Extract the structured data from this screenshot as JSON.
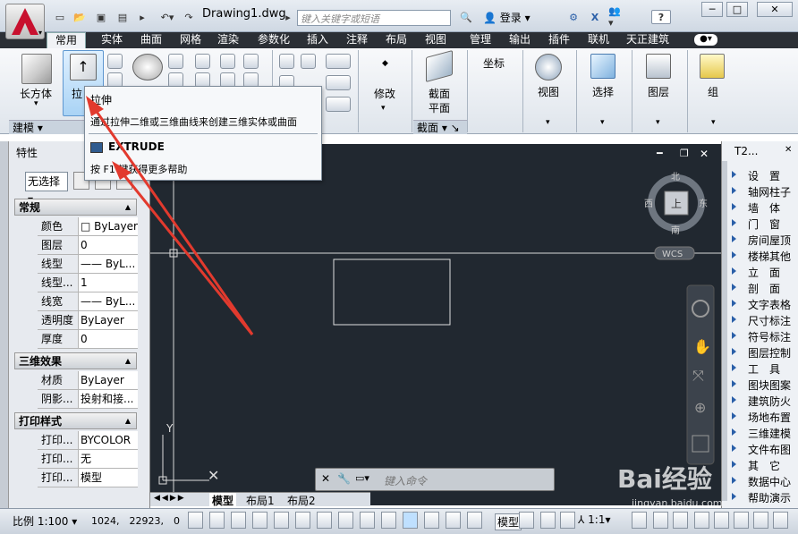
{
  "title_bar": {
    "document_title": "Drawing1.dwg",
    "search_placeholder": "键入关键字或短语",
    "login_label": "登录",
    "help_label": "?"
  },
  "tabs": [
    "常用",
    "实体",
    "曲面",
    "网格",
    "渲染",
    "参数化",
    "插入",
    "注释",
    "布局",
    "视图",
    "管理",
    "输出",
    "插件",
    "联机",
    "天正建筑"
  ],
  "active_tab": "常用",
  "ribbon": {
    "box_label": "长方体",
    "extrude_label": "拉",
    "modeling_group": "建模",
    "modify_label": "修改",
    "section_label_1": "截面",
    "section_label_2": "平面",
    "section_group": "截面",
    "coordinates_label": "坐标",
    "view_label": "视图",
    "select_label": "选择",
    "layer_label": "图层",
    "group_label": "组"
  },
  "tooltip": {
    "title": "拉伸",
    "description": "通过拉伸二维或三维曲线来创建三维实体或曲面",
    "command": "EXTRUDE",
    "help_text": "按 F1 键获得更多帮助"
  },
  "properties": {
    "panel_title": "特性",
    "selection_value": "无选择",
    "sections": [
      {
        "title": "常规",
        "rows": [
          {
            "key": "颜色",
            "value": "□ ByLayer"
          },
          {
            "key": "图层",
            "value": "0"
          },
          {
            "key": "线型",
            "value": "—— ByL..."
          },
          {
            "key": "线型...",
            "value": "1"
          },
          {
            "key": "线宽",
            "value": "—— ByL..."
          },
          {
            "key": "透明度",
            "value": "ByLayer"
          },
          {
            "key": "厚度",
            "value": "0"
          }
        ]
      },
      {
        "title": "三维效果",
        "rows": [
          {
            "key": "材质",
            "value": "ByLayer"
          },
          {
            "key": "阴影...",
            "value": "投射和接..."
          }
        ]
      },
      {
        "title": "打印样式",
        "rows": [
          {
            "key": "打印...",
            "value": "BYCOLOR"
          },
          {
            "key": "打印...",
            "value": "无"
          },
          {
            "key": "打印...",
            "value": "模型"
          }
        ]
      }
    ]
  },
  "viewcube": {
    "north": "北",
    "south": "南",
    "east": "东",
    "west": "西",
    "top": "上",
    "ucs": "WCS"
  },
  "axis_y_label": "Y",
  "command_line": {
    "placeholder": "键入命令"
  },
  "layout_tabs": [
    "模型",
    "布局1",
    "布局2"
  ],
  "right_panel": {
    "title": "T2...",
    "items": [
      "设　置",
      "轴网柱子",
      "墙　体",
      "门　窗",
      "房间屋顶",
      "楼梯其他",
      "立　面",
      "剖　面",
      "文字表格",
      "尺寸标注",
      "符号标注",
      "图层控制",
      "工　具",
      "图块图案",
      "建筑防火",
      "场地布置",
      "三维建模",
      "文件布图",
      "其　它",
      "数据中心",
      "帮助演示"
    ]
  },
  "status_bar": {
    "scale": "比例 1:100",
    "coordinates": "1024,　22923,　0",
    "model_label": "模型",
    "annotation_scale": "1:1"
  },
  "watermark": {
    "text": "Bai经验",
    "url": "jingyan.baidu.com"
  },
  "colors": {
    "canvas_bg": "#212830",
    "arrow": "#e23a2e",
    "tab_bar": "#2b2f35"
  }
}
